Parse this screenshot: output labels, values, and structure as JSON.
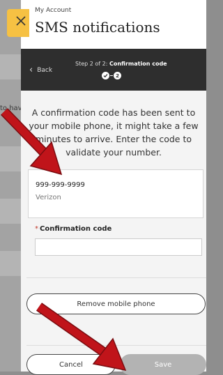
{
  "background_page": {
    "partial_text": "to hav"
  },
  "header": {
    "eyebrow": "My Account",
    "title": "SMS notifications"
  },
  "stepbar": {
    "back_label": "Back",
    "step_prefix": "Step 2 of 2: ",
    "step_name": "Confirmation code",
    "current_step_number": "2"
  },
  "message": "A confirmation code has been sent to your mobile phone, it might take a few minutes to arrive. Enter the code to validate your number.",
  "phone": {
    "number": "999-999-9999",
    "carrier": "Verizon"
  },
  "code_field": {
    "required_marker": "*",
    "label": "Confirmation code",
    "value": ""
  },
  "buttons": {
    "remove": "Remove mobile phone",
    "cancel": "Cancel",
    "save": "Save"
  },
  "colors": {
    "accent_tab": "#f6c143",
    "stepbar_bg": "#2e2e2e",
    "annotation_arrow": "#c0141a",
    "save_disabled": "#b3b3b3"
  },
  "icons": {
    "close": "close-icon",
    "back": "chevron-left-icon",
    "step_done": "check-icon"
  }
}
